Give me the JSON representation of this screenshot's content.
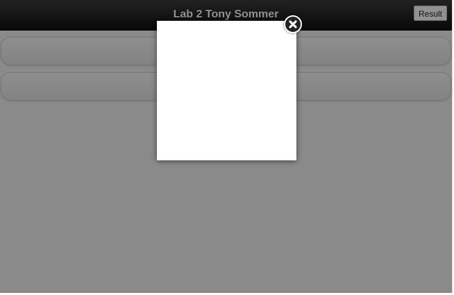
{
  "header": {
    "title": "Lab 2 Tony Sommer",
    "result_label": "Result"
  },
  "list": {
    "rows": [
      {
        "label": ""
      },
      {
        "label": ""
      }
    ]
  },
  "popup": {
    "close_icon": "close-icon"
  },
  "colors": {
    "header_bg": "#1f1f1f",
    "page_bg": "#f2f2f2",
    "overlay": "rgba(0,0,0,0.43)",
    "popup_bg": "#ffffff"
  }
}
